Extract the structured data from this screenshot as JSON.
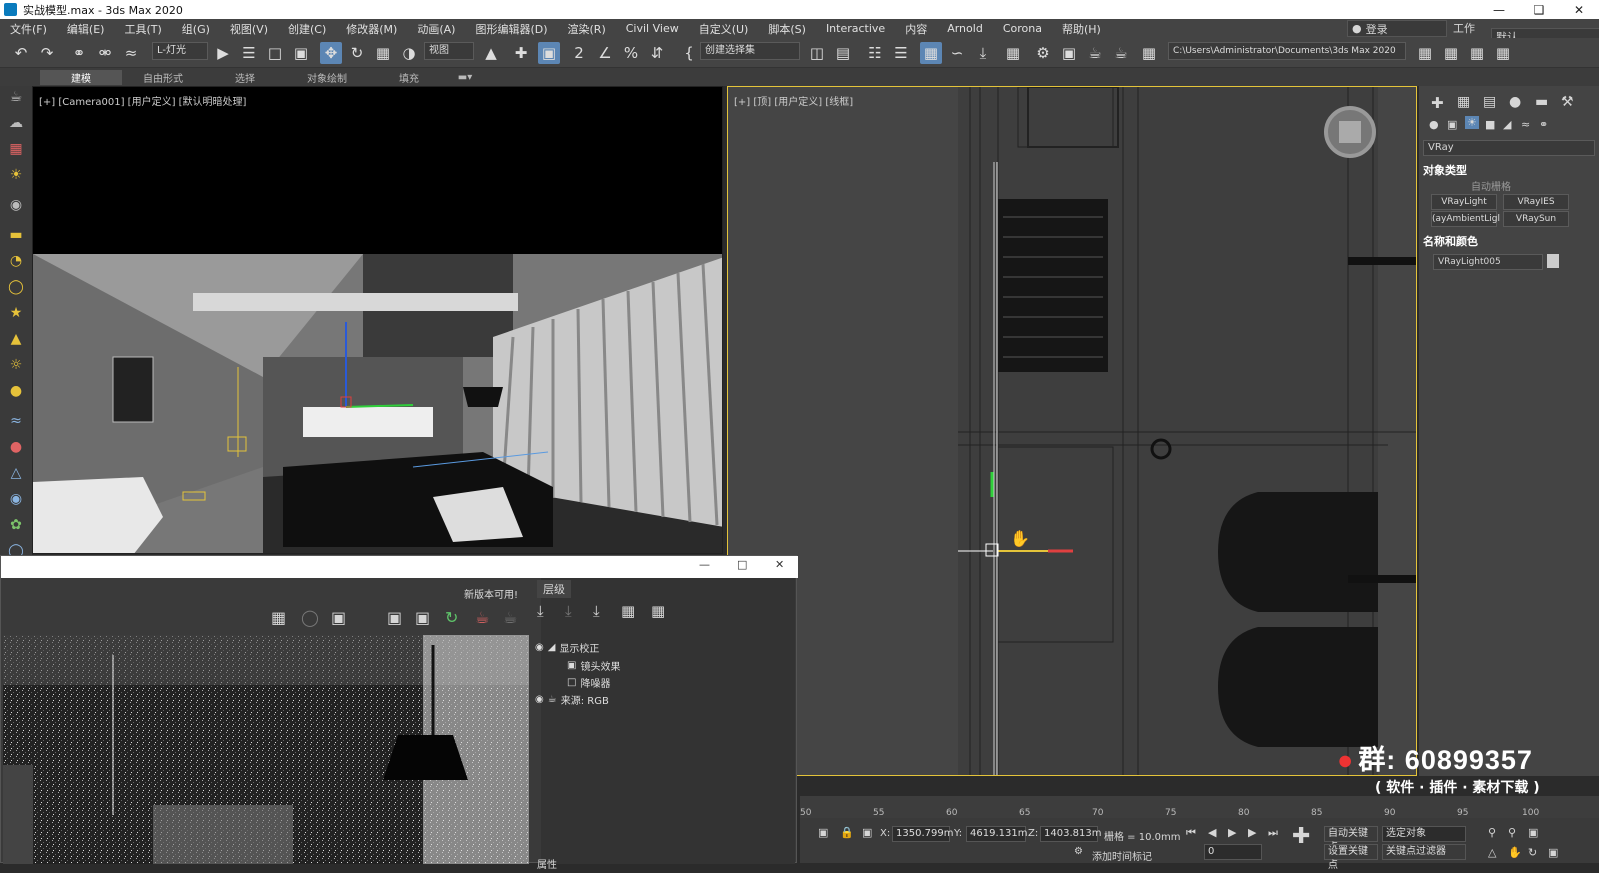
{
  "window": {
    "title": "实战模型.max - 3ds Max 2020"
  },
  "menu": [
    "文件(F)",
    "编辑(E)",
    "工具(T)",
    "组(G)",
    "视图(V)",
    "创建(C)",
    "修改器(M)",
    "动画(A)",
    "图形编辑器(D)",
    "渲染(R)",
    "Civil View",
    "自定义(U)",
    "脚本(S)",
    "Interactive",
    "内容",
    "Arnold",
    "Corona",
    "帮助(H)"
  ],
  "login": "登录",
  "workspace": {
    "label": "工作区:",
    "value": "默认"
  },
  "toolbar": {
    "selection_filter": "L-灯光",
    "ref_coord": "视图",
    "selection_set": "创建选择集",
    "path": "C:\\Users\\Administrator\\Documents\\3ds Max 2020"
  },
  "ribbon_tabs": [
    "建模",
    "自由形式",
    "选择",
    "对象绘制",
    "填充"
  ],
  "viewport_camera": {
    "label": "[+] [Camera001] [用户定义] [默认明暗处理]"
  },
  "viewport_top": {
    "label": "[+] [顶] [用户定义] [线框]"
  },
  "cmd_panel": {
    "renderer": "VRay",
    "object_type_title": "对象类型",
    "auto_grid": "自动栅格",
    "buttons": [
      "VRayLight",
      "VRayIES",
      "(ayAmbientLigl",
      "VRaySun"
    ],
    "name_color_title": "名称和颜色",
    "object_name": "VRayLight005"
  },
  "timeline": {
    "ticks": [
      "50",
      "55",
      "60",
      "65",
      "70",
      "75",
      "80",
      "85",
      "90",
      "95",
      "100"
    ]
  },
  "status": {
    "x_label": "X:",
    "x": "1350.799m",
    "y_label": "Y:",
    "y": "4619.131m",
    "z_label": "Z:",
    "z": "1403.813m",
    "grid": "栅格 = 10.0mm",
    "auto_key": "自动关键点",
    "set_key": "设置关键点",
    "key_mode": "选定对象",
    "key_filter": "关键点过滤器",
    "frame": "0",
    "add_time_tag": "添加时间标记"
  },
  "vfb": {
    "new_version": "新版本可用!",
    "layers_tab": "层级",
    "layers": [
      "显示校正",
      "镜头效果",
      "降噪器",
      "来源: RGB"
    ],
    "bottom_label": "属性"
  },
  "watermark": {
    "qq_group": "群: 60899357",
    "subtitle": "( 软件 · 插件 · 素材下载 )"
  }
}
